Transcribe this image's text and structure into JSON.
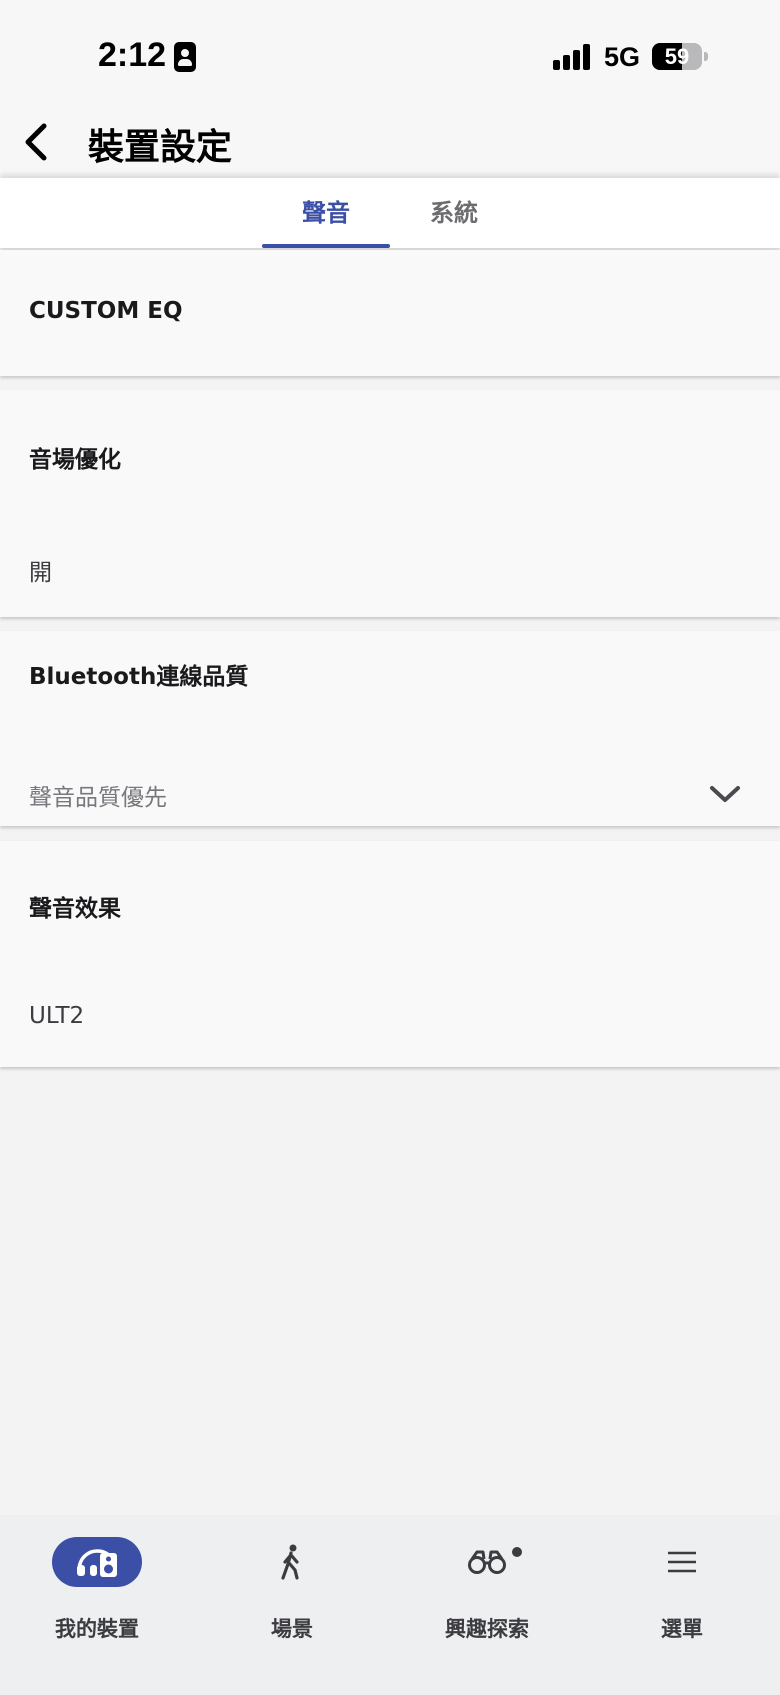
{
  "status_bar": {
    "time": "2:12",
    "network": "5G",
    "battery_level": "59",
    "battery_fraction": 0.59
  },
  "header": {
    "title": "裝置設定",
    "back_icon": "chevron-left-icon"
  },
  "tabs": [
    {
      "label": "聲音",
      "active": true
    },
    {
      "label": "系統",
      "active": false
    }
  ],
  "settings": {
    "custom_eq": {
      "title": "CUSTOM EQ"
    },
    "sound_field": {
      "title": "音場優化",
      "value": "開"
    },
    "bt_quality": {
      "title": "Bluetooth連線品質",
      "value": "聲音品質優先",
      "icon": "chevron-down-icon"
    },
    "sound_effect": {
      "title": "聲音效果",
      "value": "ULT2"
    }
  },
  "bottom_nav": [
    {
      "label": "我的裝置",
      "icon": "device-icon",
      "active": true
    },
    {
      "label": "場景",
      "icon": "walking-icon",
      "active": false
    },
    {
      "label": "興趣探索",
      "icon": "binoculars-icon",
      "active": false,
      "badge": true
    },
    {
      "label": "選單",
      "icon": "menu-icon",
      "active": false
    }
  ],
  "colors": {
    "accent": "#3a4fa5",
    "background": "#f3f3f4",
    "card": "#f9f9fa",
    "nav_background": "#edeff1"
  }
}
